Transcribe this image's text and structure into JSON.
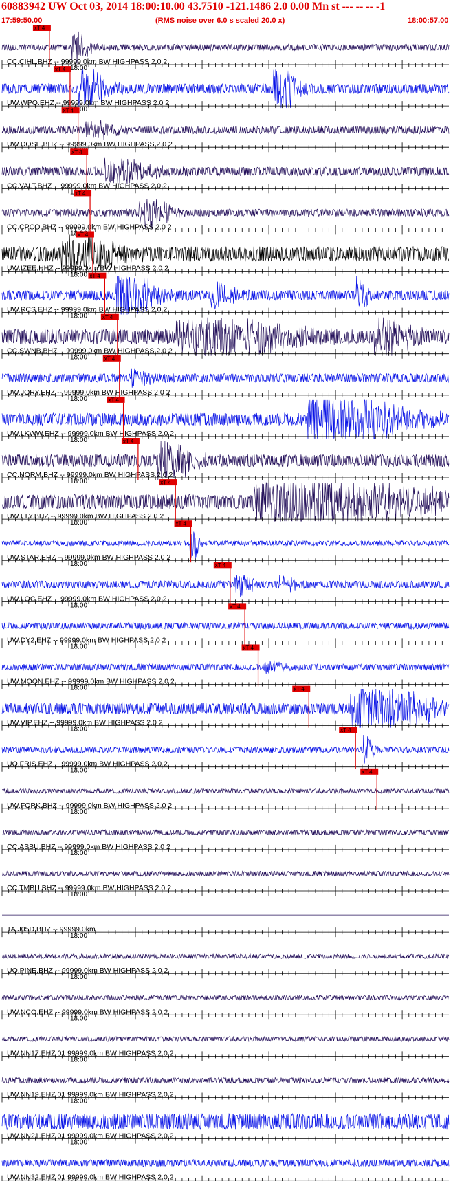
{
  "header": {
    "title": "60883942 UW Oct 03, 2014 18:00:10.00   43.7510 -121.1486  2.0 0.00 Mn st --- -- --  -1",
    "time_start": "17:59:50.00",
    "subtitle": "(RMS noise over 6.0 s scaled 20.0 x)",
    "time_end": "18:00:57.00"
  },
  "colors": {
    "header_text": "#e00000",
    "trace_blue": "#0a14e6",
    "trace_navy": "#24105a",
    "trace_black": "#000000",
    "pick": "#e00000",
    "axis": "#000000"
  },
  "chart_data": {
    "type": "seismogram",
    "x_range_s": [
      0,
      67
    ],
    "minute_mark_label": "18:00",
    "minute_mark_s": 10,
    "pick_label": "xT 4",
    "traces": [
      {
        "label": "CC.CIHL.BHZ -- 99999.0km BW  HIGHPASS  2.0  2",
        "color": "navy",
        "pick_s": 7.1,
        "events": [
          {
            "t": 11.0,
            "amp": 2.2,
            "w": 1.5
          }
        ],
        "noise": 0.5
      },
      {
        "label": "UW.WPO.EHZ -- 99999.0km BW  HIGHPASS  2.0  2",
        "color": "blue",
        "pick_s": 10.2,
        "events": [
          {
            "t": 12.5,
            "amp": 3.0,
            "w": 2.5
          },
          {
            "t": 41.5,
            "amp": 3.5,
            "w": 2.0
          }
        ],
        "noise": 0.8
      },
      {
        "label": "UW.DOSE.BHZ -- 99999.0km BW  HIGHPASS  2.0  2",
        "color": "navy",
        "pick_s": 11.4,
        "events": [
          {
            "t": 13.5,
            "amp": 1.3,
            "w": 2.5
          }
        ],
        "noise": 0.6
      },
      {
        "label": "CC.VALT.BHZ -- 99999.0km BW  HIGHPASS  2.0  2",
        "color": "navy",
        "pick_s": 12.7,
        "events": [
          {
            "t": 17.0,
            "amp": 1.8,
            "w": 4.0
          }
        ],
        "noise": 0.7
      },
      {
        "label": "CC.CPCO.BHZ -- 99999.0km BW  HIGHPASS  2.0  2",
        "color": "navy",
        "pick_s": 13.2,
        "events": [
          {
            "t": 21.5,
            "amp": 2.6,
            "w": 2.5
          }
        ],
        "noise": 0.6
      },
      {
        "label": "UW.IZEE.HHZ -- 99999.0km BW  HIGHPASS  2.0  2",
        "color": "black",
        "pick_s": 13.6,
        "events": [
          {
            "t": 10.5,
            "amp": 3.0,
            "w": 4.5
          }
        ],
        "noise": 1.2
      },
      {
        "label": "UW.RCS.EHZ -- 99999.0km BW  HIGHPASS  2.0  2",
        "color": "blue",
        "pick_s": 15.4,
        "events": [
          {
            "t": 18.5,
            "amp": 3.5,
            "w": 3.5
          },
          {
            "t": 32.0,
            "amp": 2.0,
            "w": 2.0
          },
          {
            "t": 53.5,
            "amp": 2.5,
            "w": 1.0
          }
        ],
        "noise": 0.8
      },
      {
        "label": "CC.SWNB.BHZ -- 99999.0km BW  HIGHPASS  2.0  2",
        "color": "navy",
        "pick_s": 17.3,
        "events": [
          {
            "t": 30.0,
            "amp": 2.5,
            "w": 10.0
          },
          {
            "t": 57.0,
            "amp": 2.8,
            "w": 3.0
          }
        ],
        "noise": 1.2
      },
      {
        "label": "UW.JORY.EHZ -- 99999.0km BW  HIGHPASS  2.0  2",
        "color": "blue",
        "pick_s": 17.6,
        "events": [
          {
            "t": 20.0,
            "amp": 1.0,
            "w": 2.0
          }
        ],
        "noise": 0.7
      },
      {
        "label": "UW.LKWW.EHZ -- 99999.0km BW  HIGHPASS  2.0  2",
        "color": "blue",
        "pick_s": 18.2,
        "events": [
          {
            "t": 49.0,
            "amp": 4.0,
            "w": 8.0
          }
        ],
        "noise": 1.0
      },
      {
        "label": "CC.NORM.BHZ -- 99999.0km BW  HIGHPASS  2.0  2",
        "color": "navy",
        "pick_s": 20.4,
        "events": [
          {
            "t": 24.5,
            "amp": 2.8,
            "w": 3.0
          }
        ],
        "noise": 1.0
      },
      {
        "label": "UW.LTY.BHZ -- 99999.0km BW  HIGHPASS  2.0  2",
        "color": "navy",
        "pick_s": 26.0,
        "events": [
          {
            "t": 44.0,
            "amp": 3.5,
            "w": 16.0
          }
        ],
        "noise": 1.2
      },
      {
        "label": "UW.STAR.EHZ -- 99999.0km BW  HIGHPASS  2.0  2",
        "color": "blue",
        "pick_s": 28.3,
        "events": [
          {
            "t": 28.5,
            "amp": 3.0,
            "w": 0.8
          }
        ],
        "noise": 0.4
      },
      {
        "label": "UW.LOC.EHZ -- 99999.0km BW  HIGHPASS  2.0  2",
        "color": "blue",
        "pick_s": 34.2,
        "events": [
          {
            "t": 35.5,
            "amp": 1.5,
            "w": 1.5
          },
          {
            "t": 42.0,
            "amp": 1.2,
            "w": 1.5
          }
        ],
        "noise": 0.6
      },
      {
        "label": "UW.DY2.EHZ -- 99999.0km BW  HIGHPASS  2.0  2",
        "color": "blue",
        "pick_s": 36.4,
        "events": [],
        "noise": 0.5
      },
      {
        "label": "UW.MOON.EHZ -- 99999.0km BW  HIGHPASS  2.0  2",
        "color": "blue",
        "pick_s": 38.4,
        "events": [
          {
            "t": 40.0,
            "amp": 0.9,
            "w": 2.0
          }
        ],
        "noise": 0.5
      },
      {
        "label": "UW.VIP.EHZ -- 99999.0km BW  HIGHPASS  2.0  2",
        "color": "blue",
        "pick_s": 46.0,
        "events": [
          {
            "t": 55.0,
            "amp": 3.5,
            "w": 7.0
          }
        ],
        "noise": 0.9
      },
      {
        "label": "UO.FRIS.EHZ -- 99999.0km BW  HIGHPASS  2.0  2",
        "color": "blue",
        "pick_s": 53.0,
        "events": [
          {
            "t": 54.5,
            "amp": 2.5,
            "w": 0.8
          }
        ],
        "noise": 0.5
      },
      {
        "label": "UW.FORK.BHZ -- 99999.0km BW  HIGHPASS  2.0  2",
        "color": "navy",
        "pick_s": 56.2,
        "events": [],
        "noise": 0.35
      },
      {
        "label": "CC.ASBU.BHZ -- 99999.0km BW  HIGHPASS  2.0  2",
        "color": "navy",
        "events": [],
        "noise": 0.4
      },
      {
        "label": "CC.TMBU.BHZ -- 99999.0km BW  HIGHPASS  2.0  2",
        "color": "navy",
        "events": [],
        "noise": 0.4
      },
      {
        "label": "TA.J05D.BHZ -- 99999.0km",
        "color": "navy",
        "events": [],
        "noise": 0.0
      },
      {
        "label": "UO.PINE.BHZ -- 99999.0km BW  HIGHPASS  2.0  2",
        "color": "navy",
        "events": [],
        "noise": 0.35
      },
      {
        "label": "UW.NCO.EHZ -- 99999.0km BW  HIGHPASS  2.0  2",
        "color": "navy",
        "events": [],
        "noise": 0.35
      },
      {
        "label": "UW.NN17.EHZ 01 99999.0km BW  HIGHPASS  2.0  2",
        "color": "navy",
        "events": [],
        "noise": 0.4
      },
      {
        "label": "UW.NN19.EHZ 01 99999.0km BW  HIGHPASS  2.0  2",
        "color": "navy",
        "events": [],
        "noise": 0.45
      },
      {
        "label": "UW.NN21.EHZ 01 99999.0km BW  HIGHPASS  2.0  2",
        "color": "blue",
        "events": [],
        "noise": 1.3
      },
      {
        "label": "UW.NN32.EHZ 01 99999.0km BW  HIGHPASS  2.0  2",
        "color": "blue",
        "events": [],
        "noise": 0.55
      }
    ]
  }
}
